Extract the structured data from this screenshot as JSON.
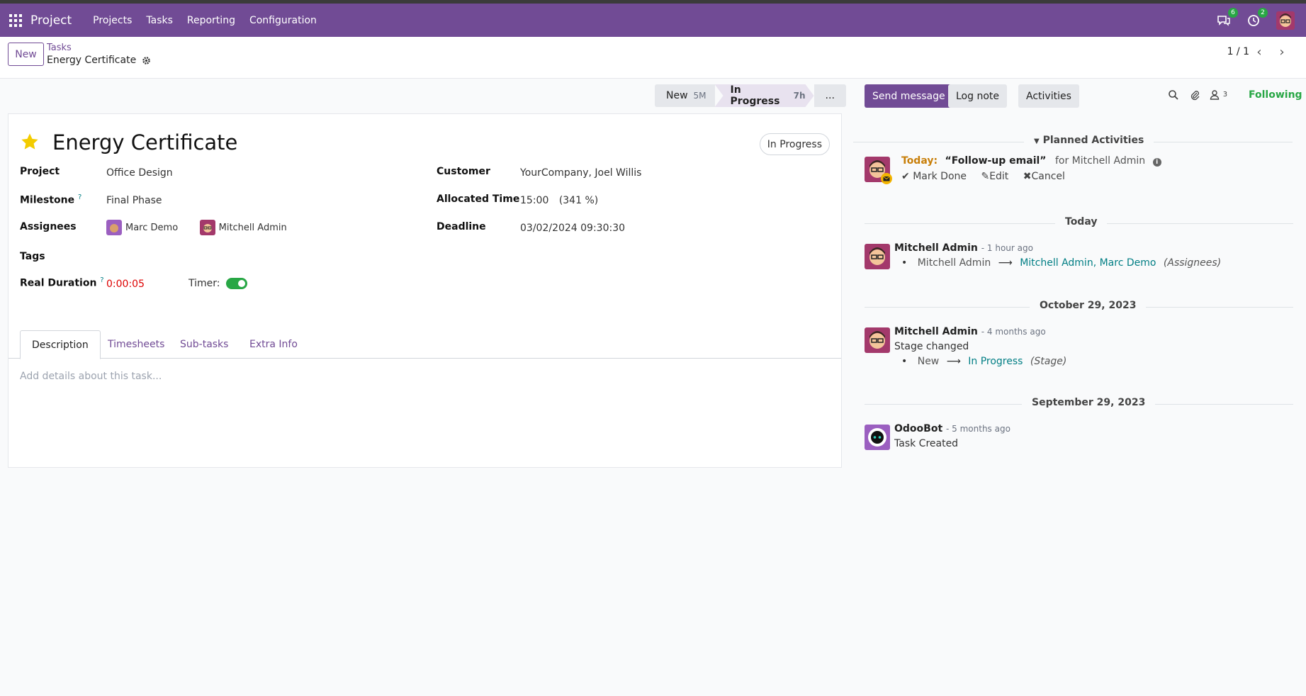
{
  "nav": {
    "brand": "Project",
    "menu": [
      "Projects",
      "Tasks",
      "Reporting",
      "Configuration"
    ],
    "messages_badge": "6",
    "activities_badge": "2"
  },
  "control_panel": {
    "new_label": "New",
    "breadcrumb_parent": "Tasks",
    "breadcrumb_current": "Energy Certificate",
    "pager": "1 / 1"
  },
  "statusbar": {
    "stages": [
      {
        "label": "New",
        "duration": "5M"
      },
      {
        "label": "In Progress",
        "duration": "7h"
      },
      {
        "label": "..."
      }
    ]
  },
  "task": {
    "title": "Energy Certificate",
    "state": "In Progress",
    "project_label": "Project",
    "project": "Office Design",
    "milestone_label": "Milestone",
    "milestone": "Final Phase",
    "assignees_label": "Assignees",
    "assignees": [
      "Marc Demo",
      "Mitchell Admin"
    ],
    "tags_label": "Tags",
    "real_duration_label": "Real Duration",
    "real_duration": "0:00:05",
    "timer_label": "Timer:",
    "customer_label": "Customer",
    "customer": "YourCompany, Joel Willis",
    "allocated_label": "Allocated Time",
    "allocated": "15:00",
    "allocated_pct": "(341 %)",
    "deadline_label": "Deadline",
    "deadline": "03/02/2024 09:30:30",
    "help_mark": "?"
  },
  "tabs": [
    "Description",
    "Timesheets",
    "Sub-tasks",
    "Extra Info"
  ],
  "description_placeholder": "Add details about this task...",
  "chatter": {
    "send_message": "Send message",
    "log_note": "Log note",
    "activities": "Activities",
    "followers_count": "3",
    "following": "Following",
    "planned_title": "Planned Activities",
    "activity": {
      "when": "Today:",
      "summary": "“Follow-up email”",
      "for": "for Mitchell Admin",
      "mark_done": "Mark Done",
      "edit": "Edit",
      "cancel": "Cancel"
    },
    "groups": [
      {
        "date": "Today"
      },
      {
        "date": "October 29, 2023"
      },
      {
        "date": "September 29, 2023"
      }
    ],
    "messages": [
      {
        "author": "Mitchell Admin",
        "ago": "- 1 hour ago",
        "old": "Mitchell Admin",
        "new": "Mitchell Admin, Marc Demo",
        "field": "(Assignees)"
      },
      {
        "author": "Mitchell Admin",
        "ago": "- 4 months ago",
        "body": "Stage changed",
        "old": "New",
        "new": "In Progress",
        "field": "(Stage)"
      },
      {
        "author": "OdooBot",
        "ago": "- 5 months ago",
        "body": "Task Created"
      }
    ]
  },
  "colors": {
    "brand": "#714b95",
    "success": "#28a745",
    "link": "#017e84",
    "danger": "#dd0000"
  }
}
